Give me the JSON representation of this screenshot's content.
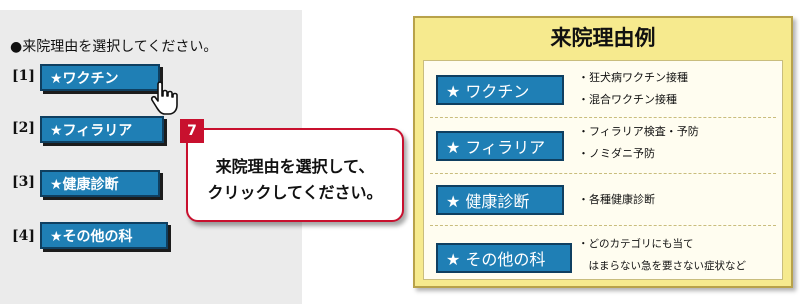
{
  "instruction": "●来院理由を選択してください。",
  "reasons": [
    {
      "number": "[1]",
      "label": "★ワクチン"
    },
    {
      "number": "[2]",
      "label": "★フィラリア"
    },
    {
      "number": "[3]",
      "label": "★健康診断"
    },
    {
      "number": "[4]",
      "label": "★その他の科"
    }
  ],
  "callout": {
    "step": "7",
    "line1": "来院理由を選択して、",
    "line2": "クリックしてください。"
  },
  "reference": {
    "title": "来院理由例",
    "items": [
      {
        "label": "★ ワクチン",
        "desc": [
          "・狂犬病ワクチン接種",
          "・混合ワクチン接種"
        ]
      },
      {
        "label": "★ フィラリア",
        "desc": [
          "・フィラリア検査・予防",
          "・ノミダニ予防"
        ]
      },
      {
        "label": "★ 健康診断",
        "desc": [
          "・各種健康診断"
        ]
      },
      {
        "label": "★ その他の科",
        "desc": [
          "・どのカテゴリにも当て",
          "　はまらない急を要さない症状など"
        ]
      }
    ]
  },
  "colors": {
    "button_blue": "#1f7fb5",
    "callout_red": "#c8102e",
    "panel_yellow": "#f6ea8e"
  },
  "icons": {
    "cursor": "pointing-hand-cursor-icon",
    "star": "star-icon"
  }
}
